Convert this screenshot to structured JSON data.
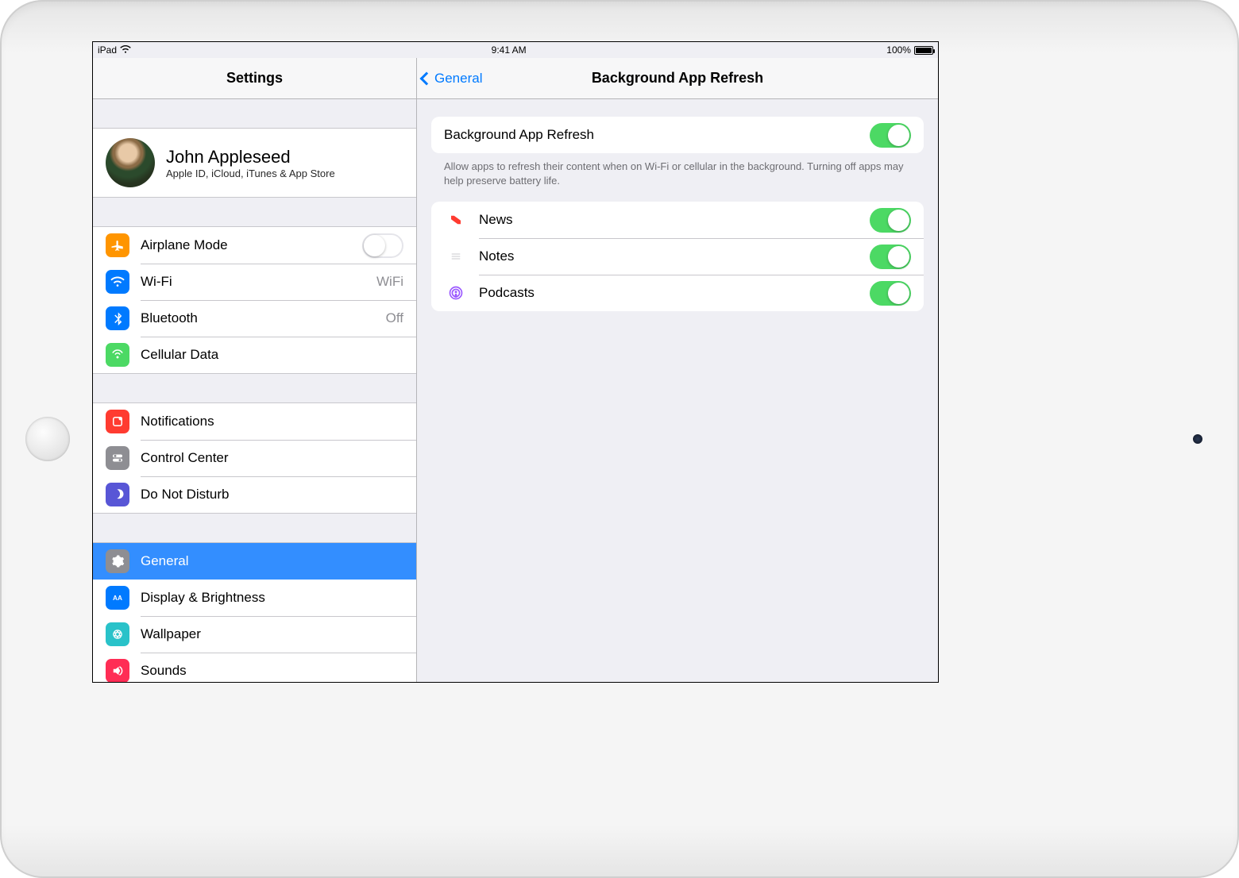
{
  "status": {
    "device": "iPad",
    "time": "9:41 AM",
    "battery_pct": "100%"
  },
  "sidebar": {
    "title": "Settings",
    "profile": {
      "name": "John Appleseed",
      "subtitle": "Apple ID, iCloud, iTunes & App Store"
    },
    "group1": [
      {
        "label": "Airplane Mode",
        "type": "toggle",
        "value": "off"
      },
      {
        "label": "Wi-Fi",
        "detail": "WiFi"
      },
      {
        "label": "Bluetooth",
        "detail": "Off"
      },
      {
        "label": "Cellular Data"
      }
    ],
    "group2": [
      {
        "label": "Notifications"
      },
      {
        "label": "Control Center"
      },
      {
        "label": "Do Not Disturb"
      }
    ],
    "group3": [
      {
        "label": "General",
        "selected": true
      },
      {
        "label": "Display & Brightness"
      },
      {
        "label": "Wallpaper"
      },
      {
        "label": "Sounds"
      }
    ]
  },
  "detail": {
    "back_label": "General",
    "title": "Background App Refresh",
    "master_toggle": {
      "label": "Background App Refresh",
      "value": "on"
    },
    "footer": "Allow apps to refresh their content when on Wi-Fi or cellular in the background. Turning off apps may help preserve battery life.",
    "apps": [
      {
        "label": "News",
        "value": "on"
      },
      {
        "label": "Notes",
        "value": "on"
      },
      {
        "label": "Podcasts",
        "value": "on"
      }
    ]
  }
}
